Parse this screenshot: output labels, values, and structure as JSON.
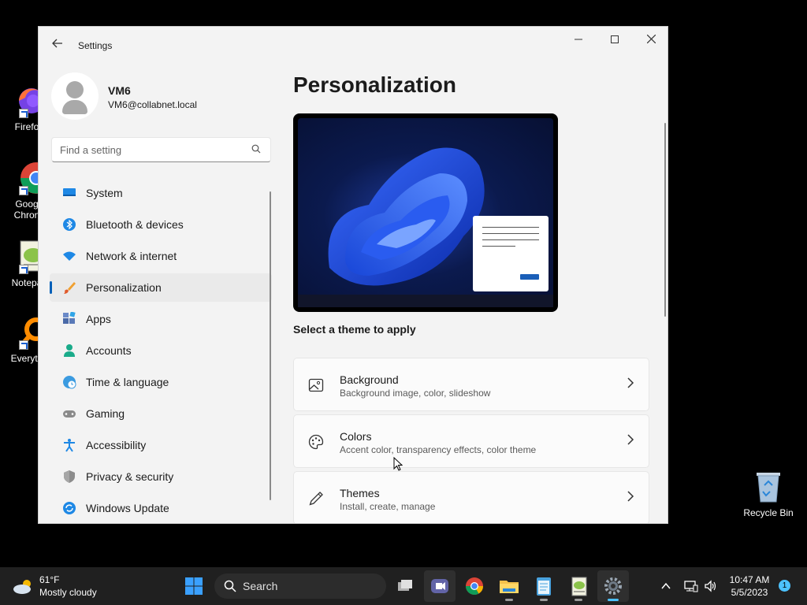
{
  "desktop": {
    "icons": [
      {
        "label": "Firefo"
      },
      {
        "label": "Goog",
        "label2": "Chron"
      },
      {
        "label": "Notepa"
      },
      {
        "label": "Everyth"
      }
    ],
    "recycle_bin": "Recycle Bin"
  },
  "window": {
    "title": "Settings",
    "user": {
      "name": "VM6",
      "email": "VM6@collabnet.local"
    },
    "search": {
      "placeholder": "Find a setting",
      "value": ""
    },
    "nav": [
      {
        "label": "System",
        "icon": "system-icon"
      },
      {
        "label": "Bluetooth & devices",
        "icon": "bluetooth-icon"
      },
      {
        "label": "Network & internet",
        "icon": "wifi-icon"
      },
      {
        "label": "Personalization",
        "icon": "brush-icon",
        "active": true
      },
      {
        "label": "Apps",
        "icon": "apps-icon"
      },
      {
        "label": "Accounts",
        "icon": "person-icon"
      },
      {
        "label": "Time & language",
        "icon": "globe-clock-icon"
      },
      {
        "label": "Gaming",
        "icon": "gamepad-icon"
      },
      {
        "label": "Accessibility",
        "icon": "accessibility-icon"
      },
      {
        "label": "Privacy & security",
        "icon": "shield-icon"
      },
      {
        "label": "Windows Update",
        "icon": "update-icon"
      }
    ],
    "page_title": "Personalization",
    "section_label": "Select a theme to apply",
    "cards": [
      {
        "title": "Background",
        "subtitle": "Background image, color, slideshow",
        "icon": "image-icon"
      },
      {
        "title": "Colors",
        "subtitle": "Accent color, transparency effects, color theme",
        "icon": "palette-icon"
      },
      {
        "title": "Themes",
        "subtitle": "Install, create, manage",
        "icon": "pen-icon"
      }
    ]
  },
  "taskbar": {
    "weather": {
      "temp": "61°F",
      "condition": "Mostly cloudy"
    },
    "search_label": "Search",
    "time": "10:47 AM",
    "date": "5/5/2023",
    "notification_count": "1"
  },
  "colors": {
    "accent": "#005fb8",
    "taskbar": "#202020",
    "window_bg": "#f3f3f3"
  }
}
